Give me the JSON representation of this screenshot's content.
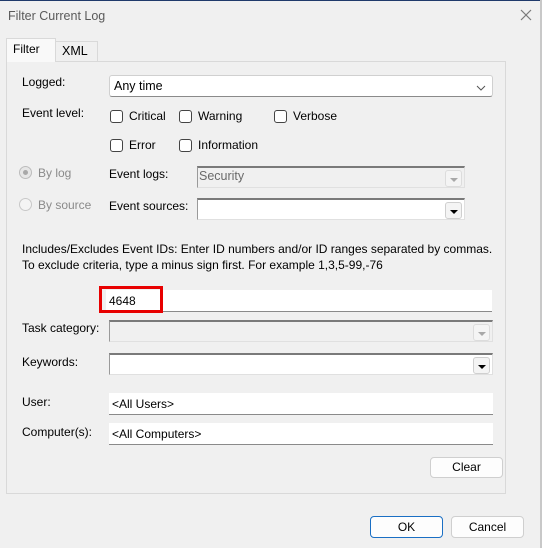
{
  "window": {
    "title": "Filter Current Log"
  },
  "tabs": [
    {
      "label": "Filter",
      "active": true
    },
    {
      "label": "XML",
      "active": false
    }
  ],
  "form": {
    "logged": {
      "label": "Logged:",
      "value": "Any time"
    },
    "event_level": {
      "label": "Event level:",
      "options": [
        {
          "label": "Critical",
          "checked": false
        },
        {
          "label": "Warning",
          "checked": false
        },
        {
          "label": "Verbose",
          "checked": false
        },
        {
          "label": "Error",
          "checked": false
        },
        {
          "label": "Information",
          "checked": false
        }
      ]
    },
    "source_mode": {
      "options": [
        {
          "label": "By log",
          "selected": true
        },
        {
          "label": "By source",
          "selected": false
        }
      ]
    },
    "event_logs": {
      "label": "Event logs:",
      "value": "Security"
    },
    "event_sources": {
      "label": "Event sources:",
      "value": ""
    },
    "event_ids": {
      "description": "Includes/Excludes Event IDs: Enter ID numbers and/or ID ranges separated by commas. To exclude criteria, type a minus sign first. For example 1,3,5-99,-76",
      "value": "4648"
    },
    "task_category": {
      "label": "Task category:",
      "value": ""
    },
    "keywords": {
      "label": "Keywords:",
      "value": ""
    },
    "user": {
      "label": "User:",
      "value": "<All Users>"
    },
    "computers": {
      "label": "Computer(s):",
      "value": "<All Computers>"
    },
    "clear_label": "Clear"
  },
  "footer": {
    "ok_label": "OK",
    "cancel_label": "Cancel"
  },
  "colors": {
    "highlight": "#e80000",
    "default_button_border": "#1a6fc4"
  }
}
